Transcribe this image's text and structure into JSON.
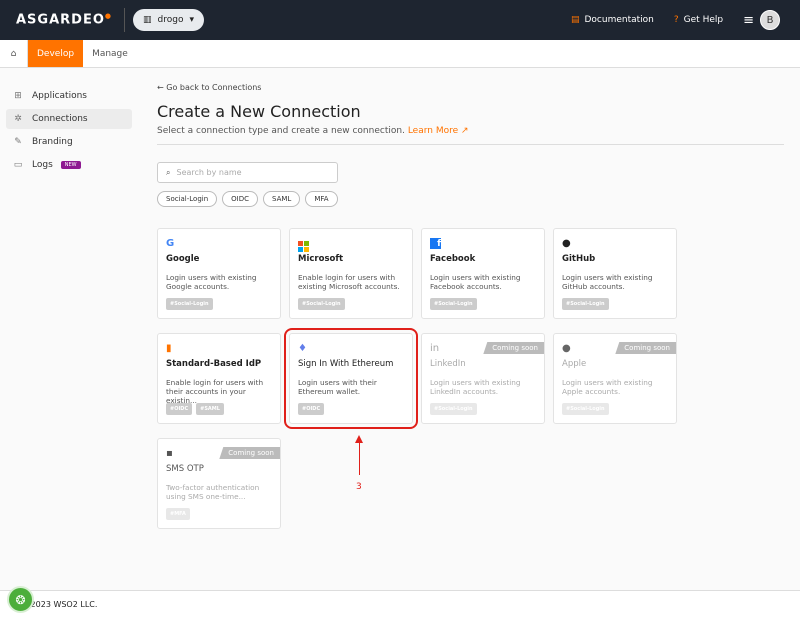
{
  "header": {
    "logo": "ASGARDEO",
    "org": "drogo",
    "documentation": "Documentation",
    "help": "Get Help",
    "avatar": "B"
  },
  "nav": {
    "tabs": [
      "Develop",
      "Manage"
    ]
  },
  "sidebar": {
    "items": [
      {
        "label": "Applications"
      },
      {
        "label": "Connections"
      },
      {
        "label": "Branding"
      },
      {
        "label": "Logs",
        "badge": "NEW"
      }
    ]
  },
  "main": {
    "back": "Go back to Connections",
    "title": "Create a New Connection",
    "subtitle": "Select a connection type and create a new connection.",
    "learn_more": "Learn More",
    "search_placeholder": "Search by name",
    "filters": [
      "Social-Login",
      "OIDC",
      "SAML",
      "MFA"
    ]
  },
  "cards": [
    {
      "title": "Google",
      "desc": "Login users with existing Google accounts.",
      "tags": [
        "#Social-Login"
      ]
    },
    {
      "title": "Microsoft",
      "desc": "Enable login for users with existing Microsoft accounts.",
      "tags": [
        "#Social-Login"
      ]
    },
    {
      "title": "Facebook",
      "desc": "Login users with existing Facebook accounts.",
      "tags": [
        "#Social-Login"
      ]
    },
    {
      "title": "GitHub",
      "desc": "Login users with existing GitHub accounts.",
      "tags": [
        "#Social-Login"
      ]
    },
    {
      "title": "Standard-Based IdP",
      "desc": "Enable login for users with their accounts in your existin...",
      "tags": [
        "#OIDC",
        "#SAML"
      ]
    },
    {
      "title": "Sign In With Ethereum",
      "desc": "Login users with their Ethereum wallet.",
      "tags": [
        "#OIDC"
      ]
    },
    {
      "title": "LinkedIn",
      "desc": "Login users with existing LinkedIn accounts.",
      "tags": [
        "#Social-Login"
      ],
      "badge": "Coming soon"
    },
    {
      "title": "Apple",
      "desc": "Login users with existing Apple accounts.",
      "tags": [
        "#Social-Login"
      ],
      "badge": "Coming soon"
    },
    {
      "title": "SMS OTP",
      "desc": "Two-factor authentication using SMS one-time...",
      "tags": [
        "#MFA"
      ],
      "badge": "Coming soon"
    }
  ],
  "annotation": "3",
  "footer": "© 2023 WSO2 LLC.",
  "colors": {
    "accent": "#ff7300",
    "header": "#1e2530",
    "highlight": "#e0201a"
  }
}
